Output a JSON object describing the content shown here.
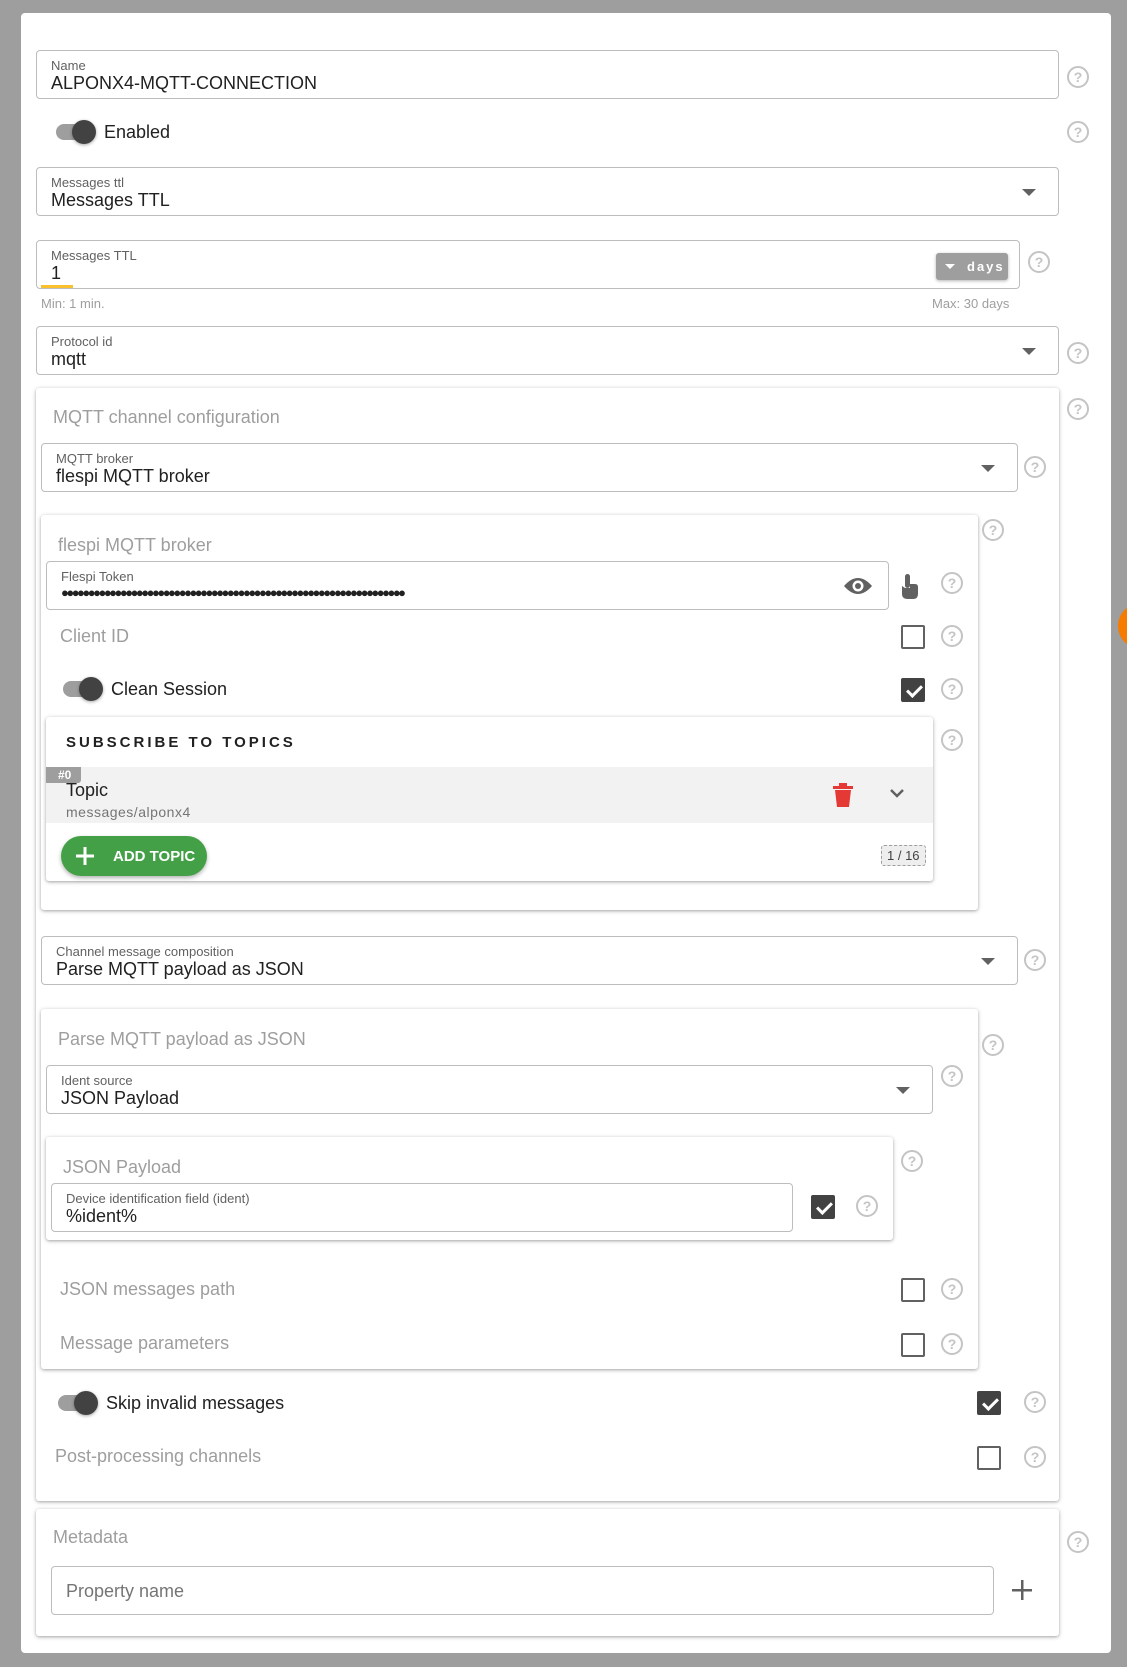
{
  "name_field": {
    "label": "Name",
    "value": "ALPONX4-MQTT-CONNECTION"
  },
  "enabled": {
    "label": "Enabled",
    "on": true
  },
  "messages_ttl_select": {
    "label": "Messages ttl",
    "value": "Messages TTL"
  },
  "messages_ttl": {
    "label": "Messages TTL",
    "value": "1",
    "unit": "days",
    "hint_min": "Min: 1 min.",
    "hint_max": "Max: 30 days"
  },
  "protocol": {
    "label": "Protocol id",
    "value": "mqtt"
  },
  "mqtt_config": {
    "title": "MQTT channel configuration",
    "broker_select": {
      "label": "MQTT broker",
      "value": "flespi MQTT broker"
    },
    "broker_section": {
      "title": "flespi MQTT broker",
      "token": {
        "label": "Flespi Token",
        "value": "●●●●●●●●●●●●●●●●●●●●●●●●●●●●●●●●●●●●●●●●●●●●●●●●●●●●●●●●●●●●●●●●"
      },
      "client_id": {
        "label": "Client ID",
        "checked": false
      },
      "clean_session": {
        "label": "Clean Session",
        "checked": true
      },
      "topics": {
        "heading": "SUBSCRIBE TO TOPICS",
        "items": [
          {
            "index": "#0",
            "label": "Topic",
            "value": "messages/alponx4"
          }
        ],
        "add_label": "ADD TOPIC",
        "counter": "1 / 16"
      }
    },
    "composition_select": {
      "label": "Channel message composition",
      "value": "Parse MQTT payload as JSON"
    },
    "json_section": {
      "title": "Parse MQTT payload as JSON",
      "ident_source": {
        "label": "Ident source",
        "value": "JSON Payload"
      },
      "json_payload": {
        "title": "JSON Payload",
        "device_field": {
          "label": "Device identification field (ident)",
          "value": "%ident%",
          "checked": true
        }
      },
      "messages_path": {
        "label": "JSON messages path",
        "checked": false
      },
      "message_params": {
        "label": "Message parameters",
        "checked": false
      }
    },
    "skip_invalid": {
      "label": "Skip invalid messages",
      "checked": true
    },
    "post_processing": {
      "label": "Post-processing channels",
      "checked": false
    }
  },
  "metadata": {
    "title": "Metadata",
    "placeholder": "Property name"
  },
  "colors": {
    "accent_green": "#43a047",
    "delete_red": "#e53935",
    "orange_fab": "#f57c00"
  },
  "icons": {
    "help": "help-circle-icon",
    "eye": "eye-icon",
    "touch": "touch-icon",
    "delete": "trash-icon",
    "expand": "chevron-down-icon",
    "add": "plus-icon"
  }
}
